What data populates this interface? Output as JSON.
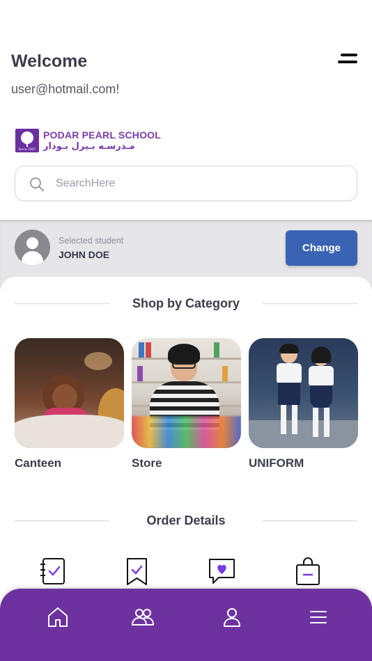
{
  "header": {
    "welcome": "Welcome",
    "email": "user@hotmail.com!",
    "menu_icon": "hamburger-menu-icon"
  },
  "school": {
    "name_en": "PODAR PEARL SCHOOL",
    "name_ar": "مـدرسـه بـيرل بـودار",
    "since": "Since 1927"
  },
  "search": {
    "placeholder": "SearchHere",
    "value": ""
  },
  "student": {
    "label": "Selected student",
    "name": "JOHN DOE",
    "change_label": "Change"
  },
  "categories_section": {
    "title": "Shop by Category",
    "items": [
      {
        "label": "Canteen"
      },
      {
        "label": "Store"
      },
      {
        "label": "UNIFORM"
      }
    ]
  },
  "orders_section": {
    "title": "Order Details",
    "icons": [
      "checklist-notebook-icon",
      "bookmark-check-icon",
      "heart-chat-icon",
      "shopping-bag-minus-icon"
    ]
  },
  "bottom_nav": {
    "items": [
      "home-icon",
      "users-icon",
      "profile-icon",
      "menu-icon"
    ]
  },
  "colors": {
    "accent_purple": "#6e32a0",
    "button_blue": "#3a63b4",
    "icon_purple": "#7a3ae0"
  }
}
